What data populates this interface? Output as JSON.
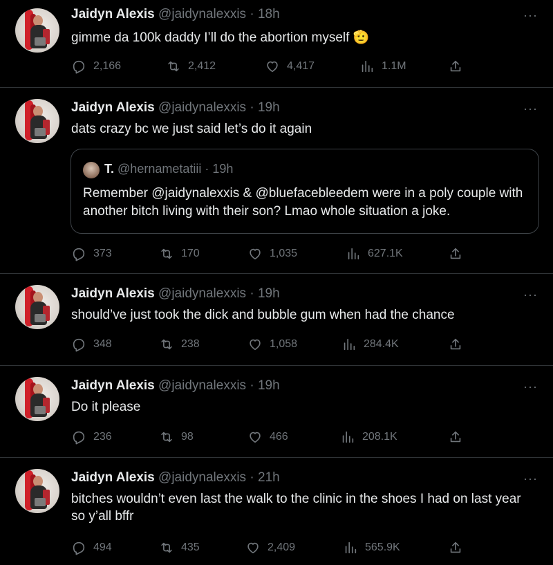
{
  "tweets": [
    {
      "name": "Jaidyn Alexis",
      "handle": "@jaidynalexxis",
      "time": "18h",
      "text": "gimme da 100k daddy I’ll do the abortion myself 🫡",
      "replies": "2,166",
      "retweets": "2,412",
      "likes": "4,417",
      "views": "1.1M"
    },
    {
      "name": "Jaidyn Alexis",
      "handle": "@jaidynalexxis",
      "time": "19h",
      "text": "dats crazy bc we just said let’s do it again",
      "quote": {
        "name": "T.",
        "handle": "@hernametatiii",
        "time": "19h",
        "text": "Remember @jaidynalexxis & @bluefacebleedem were in a poly couple with another bitch living with their son? Lmao whole situation a joke."
      },
      "replies": "373",
      "retweets": "170",
      "likes": "1,035",
      "views": "627.1K"
    },
    {
      "name": "Jaidyn Alexis",
      "handle": "@jaidynalexxis",
      "time": "19h",
      "text": "should’ve just took the dick and bubble gum when had the chance",
      "replies": "348",
      "retweets": "238",
      "likes": "1,058",
      "views": "284.4K"
    },
    {
      "name": "Jaidyn Alexis",
      "handle": "@jaidynalexxis",
      "time": "19h",
      "text": "Do it please",
      "replies": "236",
      "retweets": "98",
      "likes": "466",
      "views": "208.1K"
    },
    {
      "name": "Jaidyn Alexis",
      "handle": "@jaidynalexxis",
      "time": "21h",
      "text": "bitches wouldn’t even last the walk to the clinic in the shoes I had on last year so y’all bffr",
      "replies": "494",
      "retweets": "435",
      "likes": "2,409",
      "views": "565.9K"
    }
  ],
  "ui": {
    "separator": "·",
    "more": "···"
  },
  "colors": {
    "background": "#000000",
    "text": "#e7e9ea",
    "secondary": "#71767b",
    "divider": "#2f3336"
  },
  "icons": [
    "reply-icon",
    "retweet-icon",
    "like-icon",
    "views-icon",
    "share-icon",
    "more-icon"
  ]
}
